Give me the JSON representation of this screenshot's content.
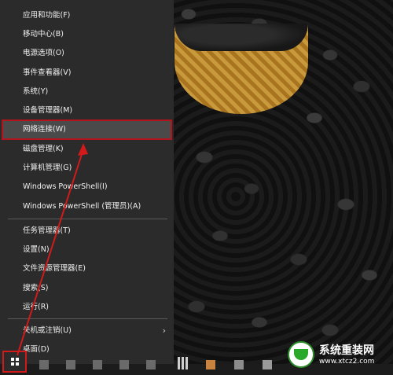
{
  "menu": {
    "items": [
      {
        "label": "应用和功能(F)"
      },
      {
        "label": "移动中心(B)"
      },
      {
        "label": "电源选项(O)"
      },
      {
        "label": "事件查看器(V)"
      },
      {
        "label": "系统(Y)"
      },
      {
        "label": "设备管理器(M)"
      },
      {
        "label": "网络连接(W)"
      },
      {
        "label": "磁盘管理(K)"
      },
      {
        "label": "计算机管理(G)"
      },
      {
        "label": "Windows PowerShell(I)"
      },
      {
        "label": "Windows PowerShell (管理员)(A)"
      },
      {
        "label": "任务管理器(T)"
      },
      {
        "label": "设置(N)"
      },
      {
        "label": "文件资源管理器(E)"
      },
      {
        "label": "搜索(S)"
      },
      {
        "label": "运行(R)"
      },
      {
        "label": "关机或注销(U)"
      },
      {
        "label": "桌面(D)"
      }
    ],
    "highlighted_item": "网络连接(W)",
    "submenu_arrow": "›"
  },
  "watermark": {
    "title": "系统重装网",
    "url": "www.xtcz2.com"
  },
  "colors": {
    "menu_bg": "#2b2b2b",
    "highlight_bg": "#4a4a4a",
    "annotation_red": "#d21a1a"
  },
  "icons": [
    "windows-logo-icon",
    "calculator-icon",
    "chevron-right-icon"
  ]
}
